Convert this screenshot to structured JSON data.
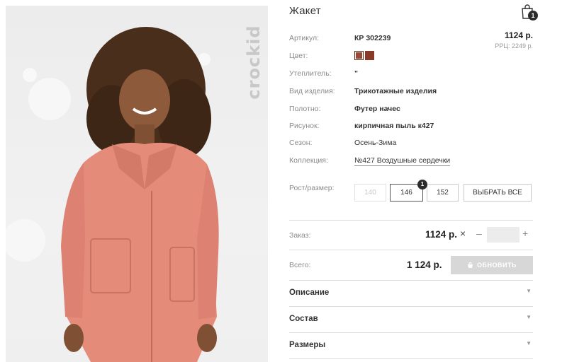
{
  "product": {
    "title": "Жакет",
    "brand": "crockid",
    "price": "1124 р.",
    "rrp": "РРЦ: 2249 р."
  },
  "cart": {
    "icon": "shopping-bag-icon",
    "count": "1"
  },
  "attributes": {
    "article_label": "Артикул:",
    "article_value": "КР 302239",
    "color_label": "Цвет:",
    "insulation_label": "Утеплитель:",
    "insulation_value": "\"",
    "type_label": "Вид изделия:",
    "type_value": "Трикотажные изделия",
    "fabric_label": "Полотно:",
    "fabric_value": "Футер начес",
    "pattern_label": "Рисунок:",
    "pattern_value": "кирпичная пыль к427",
    "season_label": "Сезон:",
    "season_value": "Осень-Зима",
    "collection_label": "Коллекция:",
    "collection_value": "№427 Воздушные сердечки"
  },
  "colors": [
    "#9a4a34",
    "#8a3a28"
  ],
  "sizes": {
    "label": "Рост/размер:",
    "options": [
      "140",
      "146",
      "152"
    ],
    "select_all": "ВЫБРАТЬ ВСЕ",
    "selected_badge": "1"
  },
  "order": {
    "label": "Заказ:",
    "price": "1124 р.",
    "remove_symbol": "×",
    "minus_symbol": "–",
    "plus_symbol": "+",
    "quantity": ""
  },
  "total": {
    "label": "Всего:",
    "value": "1 124 р.",
    "update_button": "ОБНОВИТЬ"
  },
  "accordion": {
    "description": "Описание",
    "composition": "Состав",
    "sizes": "Размеры",
    "arrow": "▼"
  }
}
